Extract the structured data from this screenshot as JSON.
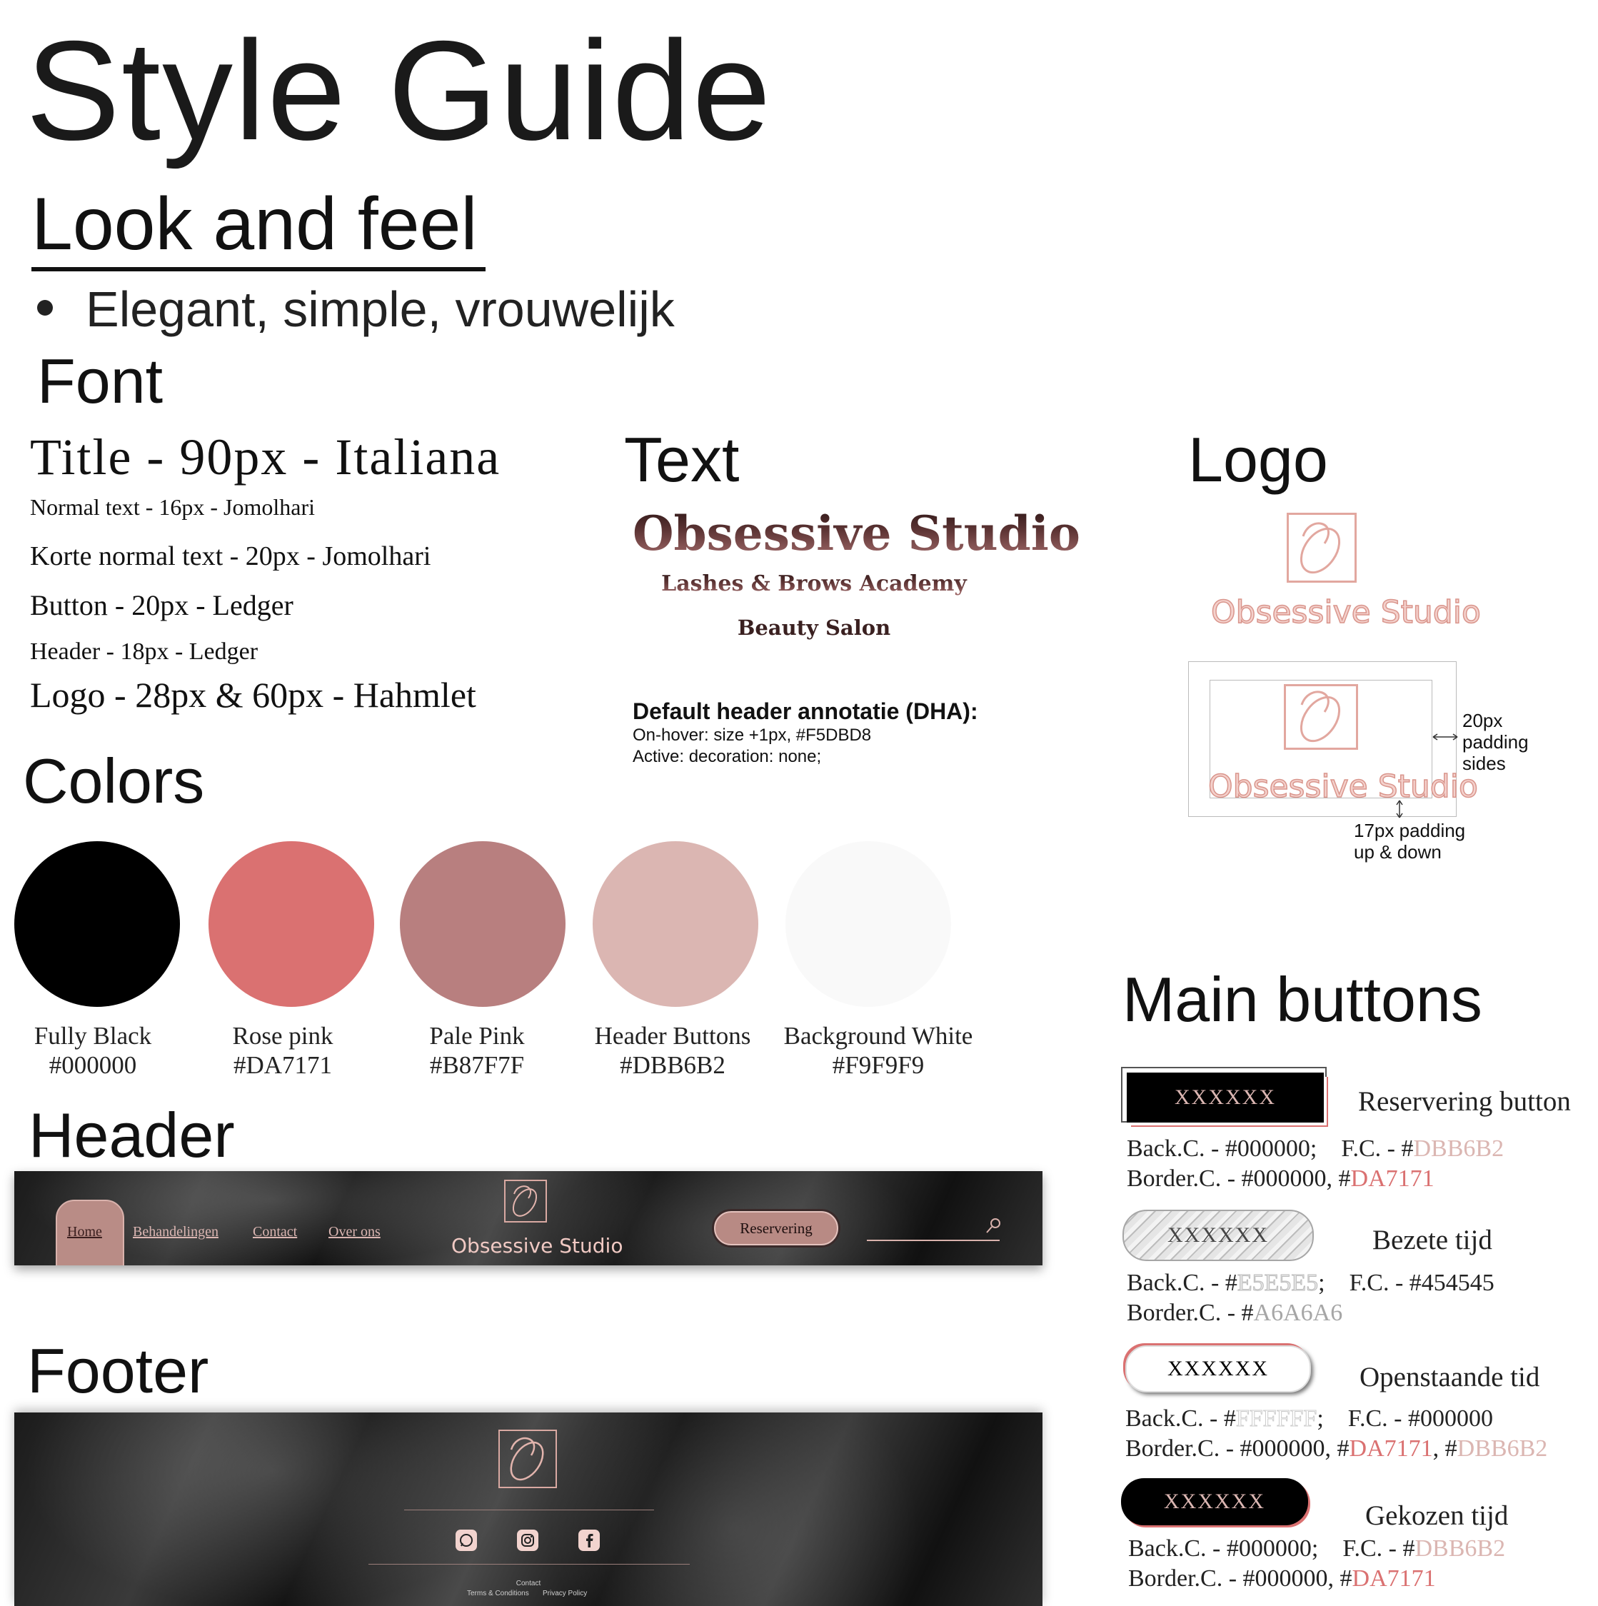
{
  "title": "Style Guide",
  "look_and_feel": {
    "heading": "Look and feel",
    "bullet": "Elegant, simple, vrouwelijk"
  },
  "font": {
    "heading": "Font",
    "specs": {
      "title": "Title - 90px - Italiana",
      "normal": "Normal text - 16px - Jomolhari",
      "korte": "Korte normal text - 20px - Jomolhari",
      "button": "Button - 20px - Ledger",
      "header": "Header - 18px - Ledger",
      "logo": "Logo - 28px & 60px - Hahmlet"
    }
  },
  "text_section": {
    "heading": "Text",
    "brand_title": "Obsessive Studio",
    "brand_sub1": "Lashes & Brows Academy",
    "brand_sub2": "Beauty Salon",
    "dha_title": "Default header annotatie (DHA):",
    "dha_line1": "On-hover: size +1px, #F5DBD8",
    "dha_line2": "Active: decoration: none;"
  },
  "logo_section": {
    "heading": "Logo",
    "wordmark": "Obsessive Studio",
    "annot_sides": "20px padding sides",
    "annot_updown": "17px padding up & down"
  },
  "colors": {
    "heading": "Colors",
    "swatches": [
      {
        "name": "Fully Black",
        "hex": "#000000"
      },
      {
        "name": "Rose pink",
        "hex": "#DA7171"
      },
      {
        "name": "Pale Pink",
        "hex": "#B87F7F"
      },
      {
        "name": "Header Buttons",
        "hex": "#DBB6B2"
      },
      {
        "name": "Background White",
        "hex": "#F9F9F9"
      }
    ]
  },
  "header_section": {
    "heading": "Header",
    "nav": [
      "Home",
      "Behandelingen",
      "Contact",
      "Over ons"
    ],
    "brand": "Obsessive Studio",
    "reserve_button": "Reservering",
    "search_icon": "search-icon"
  },
  "footer_section": {
    "heading": "Footer",
    "icons": [
      "whatsapp-icon",
      "instagram-icon",
      "facebook-icon"
    ],
    "contact": "Contact",
    "terms": "Terms & Conditions",
    "privacy": "Privacy Policy"
  },
  "buttons": {
    "heading": "Main buttons",
    "items": [
      {
        "label": "XXXXXX",
        "name": "Reservering button"
      },
      {
        "label": "XXXXXX",
        "name": "Bezete tijd"
      },
      {
        "label": "XXXXXX",
        "name": "Openstaande tid"
      },
      {
        "label": "XXXXXX",
        "name": "Gekozen tijd"
      }
    ],
    "specs": {
      "b1_back": "Back.C. - #000000;",
      "b1_fc_prefix": "F.C. - #",
      "b1_fc": "DBB6B2",
      "b1_border_prefix": "Border.C. - #000000, #",
      "b1_border": "DA7171",
      "b2_back_prefix": "Back.C. - #",
      "b2_back": "E5E5E5",
      "b2_fc": "F.C. - #454545",
      "b2_border_prefix": "Border.C. - #",
      "b2_border": "A6A6A6",
      "b3_back_prefix": "Back.C. - #",
      "b3_back": "FFFFFF",
      "b3_fc": "F.C. - #000000",
      "b3_border_prefix": "Border.C. - #000000, #",
      "b3_border1": "DA7171",
      "b3_border_sep": ", #",
      "b3_border2": "DBB6B2",
      "b4_back": "Back.C. - #000000;",
      "b4_fc_prefix": "F.C. - #",
      "b4_fc": "DBB6B2",
      "b4_border_prefix": "Border.C. - #000000, #",
      "b4_border": "DA7171"
    }
  }
}
